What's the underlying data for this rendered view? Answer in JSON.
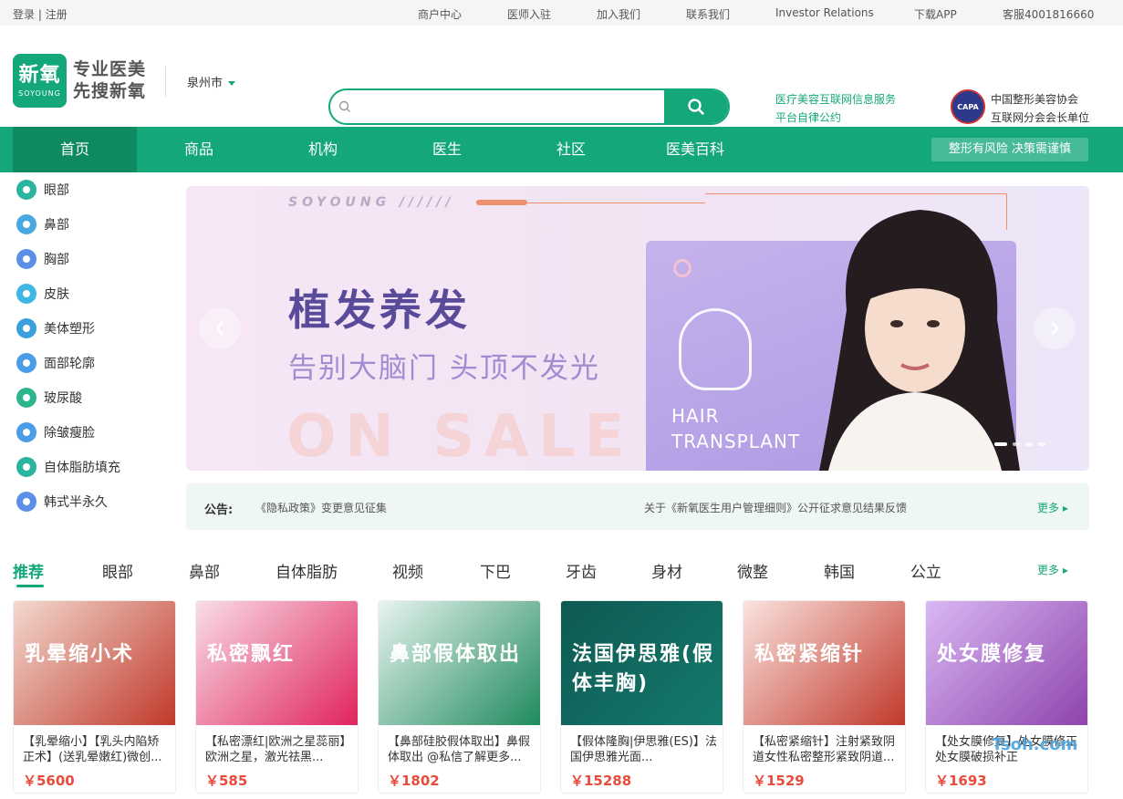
{
  "topbar": {
    "login": "登录",
    "sep": "|",
    "register": "注册",
    "links": [
      "商户中心",
      "医师入驻",
      "加入我们",
      "联系我们",
      "Investor Relations",
      "下载APP",
      "客服4001816660"
    ]
  },
  "header": {
    "logo_main": "新氧",
    "logo_sub": "SOYOUNG",
    "slogan_line1": "专业医美",
    "slogan_line2": "先搜新氧",
    "city": "泉州市",
    "search_placeholder": "",
    "service_link1": "医疗美容互联网信息服务",
    "service_link2": "平台自律公约",
    "capa_logo": "CAPA",
    "assoc_line1": "中国整形美容协会",
    "assoc_line2": "互联网分会会长单位"
  },
  "nav": {
    "items": [
      "首页",
      "商品",
      "机构",
      "医生",
      "社区",
      "医美百科"
    ],
    "risk": "整形有风险  决策需谨慎"
  },
  "sidebar": {
    "items": [
      "眼部",
      "鼻部",
      "胸部",
      "皮肤",
      "美体塑形",
      "面部轮廓",
      "玻尿酸",
      "除皱瘦脸",
      "自体脂肪填充",
      "韩式半永久"
    ]
  },
  "banner": {
    "brand": "SOYOUNG //////",
    "title": "植发养发",
    "subtitle": "告别大脑门 头顶不发光",
    "sale": "ON SALE",
    "card_text1": "HAIR",
    "card_text2": "TRANSPLANT"
  },
  "notice": {
    "label": "公告:",
    "item1": "《隐私政策》变更意见征集",
    "item2": "关于《新氧医生用户管理细则》公开征求意见结果反馈",
    "more": "更多 ▸"
  },
  "categories": {
    "tabs": [
      "推荐",
      "眼部",
      "鼻部",
      "自体脂肪",
      "视频",
      "下巴",
      "牙齿",
      "身材",
      "微整",
      "韩国",
      "公立"
    ],
    "more": "更多 ▸"
  },
  "products": [
    {
      "img_text": "乳晕缩小术",
      "title": "【乳晕缩小】【乳头内陷矫正术】(送乳晕嫩红)微创...",
      "price": "￥5600",
      "color1": "#f3d9cf",
      "color2": "#c0392b"
    },
    {
      "img_text": "私密飘红",
      "title": "【私密漂红|欧洲之星蕊丽】欧洲之星，激光祛黑...",
      "price": "￥585",
      "color1": "#f9dde6",
      "color2": "#e0245e"
    },
    {
      "img_text": "鼻部假体取出",
      "title": "【鼻部硅胶假体取出】鼻假体取出 @私信了解更多...",
      "price": "￥1802",
      "color1": "#e8f4ef",
      "color2": "#1f8a5e"
    },
    {
      "img_text": "法国伊思雅(假体丰胸)",
      "title": "【假体隆胸|伊思雅(ES)】法国伊思雅光面...",
      "price": "￥15288",
      "color1": "#0d5a52",
      "color2": "#15796c"
    },
    {
      "img_text": "私密紧缩针",
      "title": "【私密紧缩针】注射紧致阴道女性私密整形紧致阴道...",
      "price": "￥1529",
      "color1": "#fbe3df",
      "color2": "#c0392b"
    },
    {
      "img_text": "处女膜修复",
      "title": "【处女膜修复】处女膜修正处女膜破损补正",
      "price": "￥1693",
      "color1": "#d9b8f3",
      "color2": "#8e44ad"
    }
  ],
  "watermark": "Tsoh.com"
}
